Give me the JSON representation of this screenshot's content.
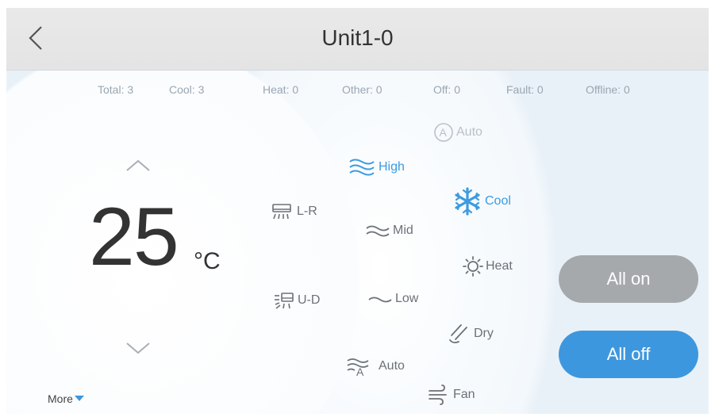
{
  "header": {
    "title": "Unit1-0"
  },
  "stats": [
    {
      "label": "Total: 3"
    },
    {
      "label": "Cool: 3"
    },
    {
      "label": "Heat: 0"
    },
    {
      "label": "Other: 0"
    },
    {
      "label": "Off: 0"
    },
    {
      "label": "Fault: 0"
    },
    {
      "label": "Offline: 0"
    }
  ],
  "temperature": {
    "value": "25",
    "unit": "°C"
  },
  "swing": [
    {
      "label": "L-R",
      "icon": "swing-lr-icon"
    },
    {
      "label": "U-D",
      "icon": "swing-ud-icon"
    }
  ],
  "fan_speed": [
    {
      "label": "High",
      "icon": "fan-high-icon",
      "selected": true
    },
    {
      "label": "Mid",
      "icon": "fan-mid-icon"
    },
    {
      "label": "Low",
      "icon": "fan-low-icon"
    },
    {
      "label": "Auto",
      "icon": "fan-auto-icon"
    }
  ],
  "mode": [
    {
      "label": "Auto",
      "icon": "auto-mode-icon",
      "disabled": true
    },
    {
      "label": "Cool",
      "icon": "snowflake-icon",
      "selected": true
    },
    {
      "label": "Heat",
      "icon": "sun-icon"
    },
    {
      "label": "Dry",
      "icon": "dry-icon"
    },
    {
      "label": "Fan",
      "icon": "fan-mode-icon"
    }
  ],
  "actions": {
    "all_on": "All on",
    "all_off": "All off"
  },
  "footer": {
    "more": "More"
  },
  "colors": {
    "accent": "#3d97de",
    "all_on_bg": "#a6a9ac",
    "text": "#333333",
    "muted": "#9aa6b1"
  }
}
